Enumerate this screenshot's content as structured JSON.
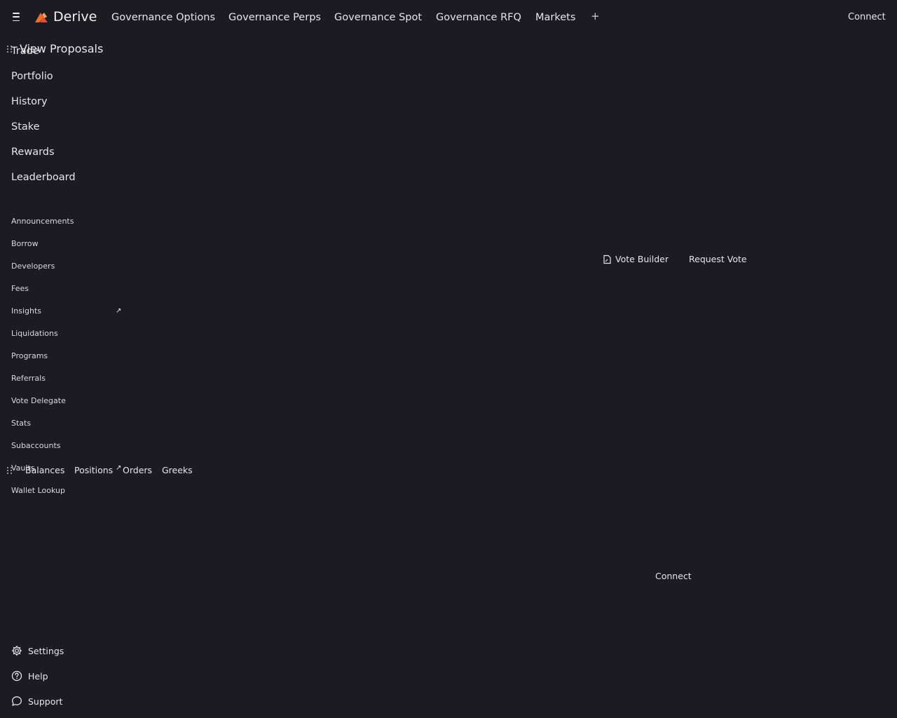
{
  "header": {
    "brand": "Derive",
    "tabs": [
      "Governance Options",
      "Governance Perps",
      "Governance Spot",
      "Governance RFQ",
      "Markets"
    ],
    "add_tab_symbol": "+",
    "connect_label": "Connect"
  },
  "sidebar": {
    "primary": [
      "Trade",
      "Portfolio",
      "History",
      "Stake",
      "Rewards",
      "Leaderboard"
    ],
    "secondary": [
      "Announcements",
      "Borrow",
      "Developers",
      "Fees",
      "Insights",
      "Liquidations",
      "Programs",
      "Referrals",
      "Vote Delegate",
      "Stats",
      "Subaccounts",
      "Vaults",
      "Wallet Lookup"
    ],
    "footer": {
      "settings": "Settings",
      "help": "Help",
      "support": "Support"
    }
  },
  "main": {
    "panel_title": "View Proposals",
    "vote_builder_label": "Vote Builder",
    "request_vote_label": "Request Vote",
    "bottom_tabs": [
      "Balances",
      "Positions",
      "Orders",
      "Greeks"
    ],
    "connect_label": "Connect"
  },
  "icons": {
    "menu": "menu-icon",
    "logo": "derive-logo-icon",
    "plus": "plus-icon",
    "drag": "drag-handle-icon",
    "external": "external-link-icon",
    "document": "document-icon",
    "settings": "gear-icon",
    "help": "help-circle-icon",
    "support": "chat-bubble-icon"
  },
  "colors": {
    "background": "#1c1b22",
    "text": "#e8e8ec",
    "logo_orange": "#f26b2e",
    "logo_red": "#e84a3a"
  }
}
